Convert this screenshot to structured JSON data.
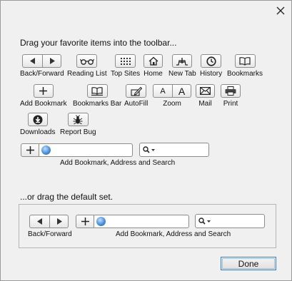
{
  "dialog": {
    "close_icon": "close-icon",
    "heading": "Drag your favorite items into the toolbar...",
    "default_heading": "...or drag the default set.",
    "done_label": "Done"
  },
  "items": {
    "back_forward": "Back/Forward",
    "reading_list": "Reading List",
    "top_sites": "Top Sites",
    "home": "Home",
    "new_tab": "New Tab",
    "history": "History",
    "bookmarks": "Bookmarks",
    "add_bookmark": "Add Bookmark",
    "bookmarks_bar": "Bookmarks Bar",
    "autofill": "AutoFill",
    "zoom": "Zoom",
    "mail": "Mail",
    "print": "Print",
    "downloads": "Downloads",
    "report_bug": "Report Bug",
    "address_search": "Add Bookmark, Address and Search"
  },
  "default_set": {
    "back_forward": "Back/Forward",
    "address_search": "Add Bookmark, Address and Search"
  },
  "zoom": {
    "small": "A",
    "large": "A"
  }
}
